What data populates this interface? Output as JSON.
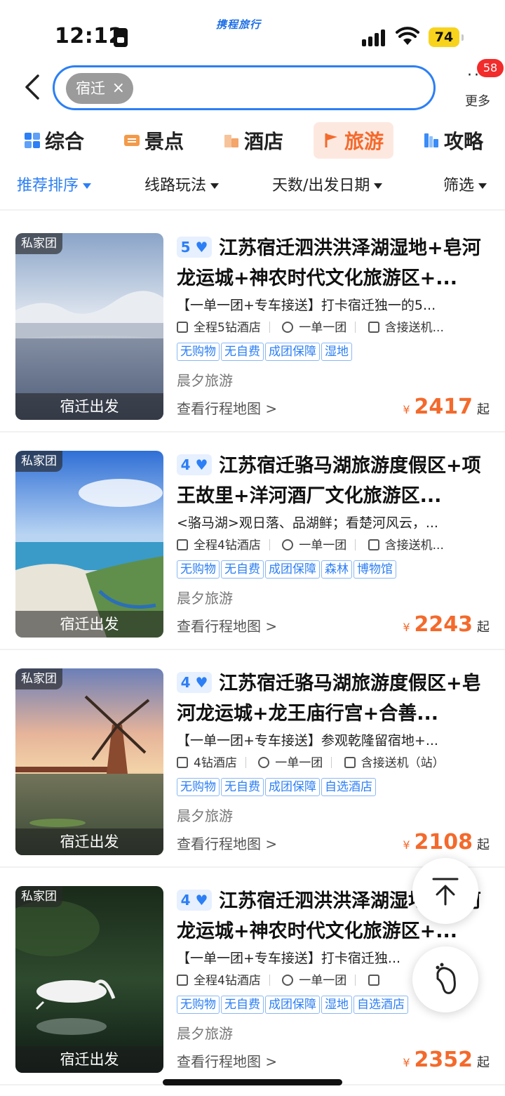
{
  "status_bar": {
    "time": "12:12",
    "brand": "携程旅行",
    "battery": "74"
  },
  "search": {
    "chip_label": "宿迁",
    "chip_close": "×"
  },
  "header": {
    "more_label": "更多",
    "more_dots": "···",
    "badge_count": "58"
  },
  "tabs": [
    {
      "label": "综合",
      "icon": "grid-icon",
      "color": "#2c7ff5"
    },
    {
      "label": "景点",
      "icon": "ticket-icon",
      "color": "#f39a4a"
    },
    {
      "label": "酒店",
      "icon": "hotel-icon",
      "color": "#f3a56a"
    },
    {
      "label": "旅游",
      "icon": "flag-icon",
      "color": "#f36a2c",
      "active": true
    },
    {
      "label": "攻略",
      "icon": "guide-icon",
      "color": "#3a8cf7"
    }
  ],
  "filters": [
    "推荐排序",
    "线路玩法",
    "天数/出发日期",
    "筛选"
  ],
  "cards": [
    {
      "tag": "私家团",
      "departure": "宿迁出发",
      "level": "5",
      "title": "江苏宿迁泗洪洪泽湖湿地+皂河龙运城+神农时代文化旅游区+...",
      "desc": "【一单一团+专车接送】打卡宿迁独一的5...",
      "meta": [
        "全程5钻酒店",
        "一单一团",
        "含接送机..."
      ],
      "tags": [
        "无购物",
        "无自费",
        "成团保障",
        "湿地"
      ],
      "agency": "晨夕旅游",
      "map_link": "查看行程地图 >",
      "currency": "¥",
      "price": "2417",
      "price_suffix": "起"
    },
    {
      "tag": "私家团",
      "departure": "宿迁出发",
      "level": "4",
      "title": "江苏宿迁骆马湖旅游度假区+项王故里+洋河酒厂文化旅游区...",
      "desc": "<骆马湖>观日落、品湖鲜；看楚河风云，...",
      "meta": [
        "全程4钻酒店",
        "一单一团",
        "含接送机..."
      ],
      "tags": [
        "无购物",
        "无自费",
        "成团保障",
        "森林",
        "博物馆"
      ],
      "agency": "晨夕旅游",
      "map_link": "查看行程地图 >",
      "currency": "¥",
      "price": "2243",
      "price_suffix": "起"
    },
    {
      "tag": "私家团",
      "departure": "宿迁出发",
      "level": "4",
      "title": "江苏宿迁骆马湖旅游度假区+皂河龙运城+龙王庙行宫+合善...",
      "desc": "【一单一团+专车接送】参观乾隆留宿地+...",
      "meta": [
        "4钻酒店",
        "一单一团",
        "含接送机（站）"
      ],
      "tags": [
        "无购物",
        "无自费",
        "成团保障",
        "自选酒店"
      ],
      "agency": "晨夕旅游",
      "map_link": "查看行程地图 >",
      "currency": "¥",
      "price": "2108",
      "price_suffix": "起"
    },
    {
      "tag": "私家团",
      "departure": "宿迁出发",
      "level": "4",
      "title": "江苏宿迁泗洪洪泽湖湿地+皂河龙运城+神农时代文化旅游区+...",
      "desc": "【一单一团+专车接送】打卡宿迁独...",
      "meta": [
        "全程4钻酒店",
        "一单一团",
        ""
      ],
      "tags": [
        "无购物",
        "无自费",
        "成团保障",
        "湿地",
        "自选酒店"
      ],
      "agency": "晨夕旅游",
      "map_link": "查看行程地图 >",
      "currency": "¥",
      "price": "2352",
      "price_suffix": "起"
    }
  ],
  "colors": {
    "accent": "#2c7ff5",
    "price": "#f36a2c",
    "badge": "#f22b2b"
  }
}
